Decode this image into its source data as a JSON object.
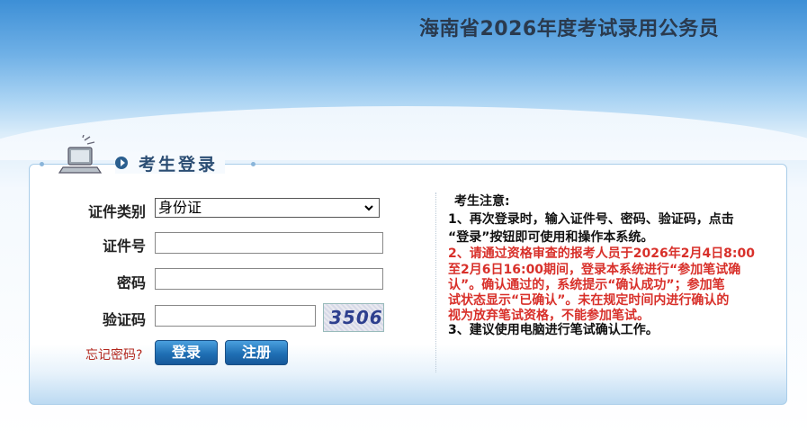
{
  "header": {
    "title": "海南省2026年度考试录用公务员"
  },
  "login": {
    "title": "考生登录",
    "id_type_label": "证件类别",
    "id_type_value": "身份证",
    "id_number_label": "证件号",
    "password_label": "密码",
    "captcha_label": "验证码",
    "captcha_text": "3506",
    "forgot_link": "忘记密码?",
    "login_button": "登录",
    "register_button": "注册"
  },
  "notice": {
    "heading": "考生注意:",
    "item1_line1": "1、再次登录时，输入证件号、密码、验证码，点击",
    "item1_line2": "“登录”按钮即可使用和操作本系统。",
    "item2_line1": "2、请通过资格审查的报考人员于2026年2月4日8:00",
    "item2_line2": "至2月6日16:00期间，登录本系统进行“参加笔试确",
    "item2_line3": "认”。确认通过的，系统提示“确认成功”；参加笔",
    "item2_line4": "试状态显示“已确认”。未在规定时间内进行确认的",
    "item2_line5": "视为放弃笔试资格，不能参加笔试。",
    "item3": "3、建议使用电脑进行笔试确认工作。"
  },
  "colors": {
    "header_blue": "#3d8fd6",
    "button_blue": "#1f6fb4",
    "notice_red": "#d8302a",
    "title_navy": "#2b4d73"
  }
}
